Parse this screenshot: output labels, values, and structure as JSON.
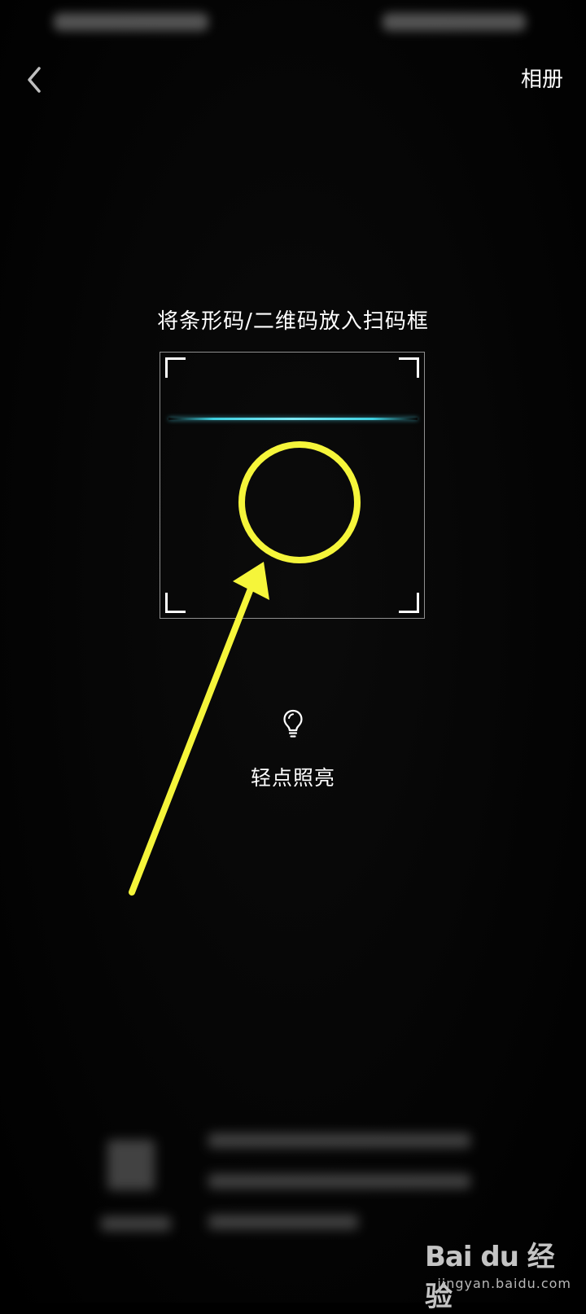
{
  "header": {
    "back_icon": "chevron-left-icon",
    "album_label": "相册"
  },
  "scan": {
    "hint": "将条形码/二维码放入扫码框",
    "frame_color": "#ffffff",
    "scan_line_color": "#3fd0e0"
  },
  "flashlight": {
    "icon": "lightbulb-icon",
    "label": "轻点照亮"
  },
  "annotation": {
    "color": "#f5f53a",
    "shapes": [
      "circle",
      "arrow"
    ]
  },
  "watermark": {
    "brand": "Bai du 经验",
    "site": "jingyan.baidu.com"
  }
}
